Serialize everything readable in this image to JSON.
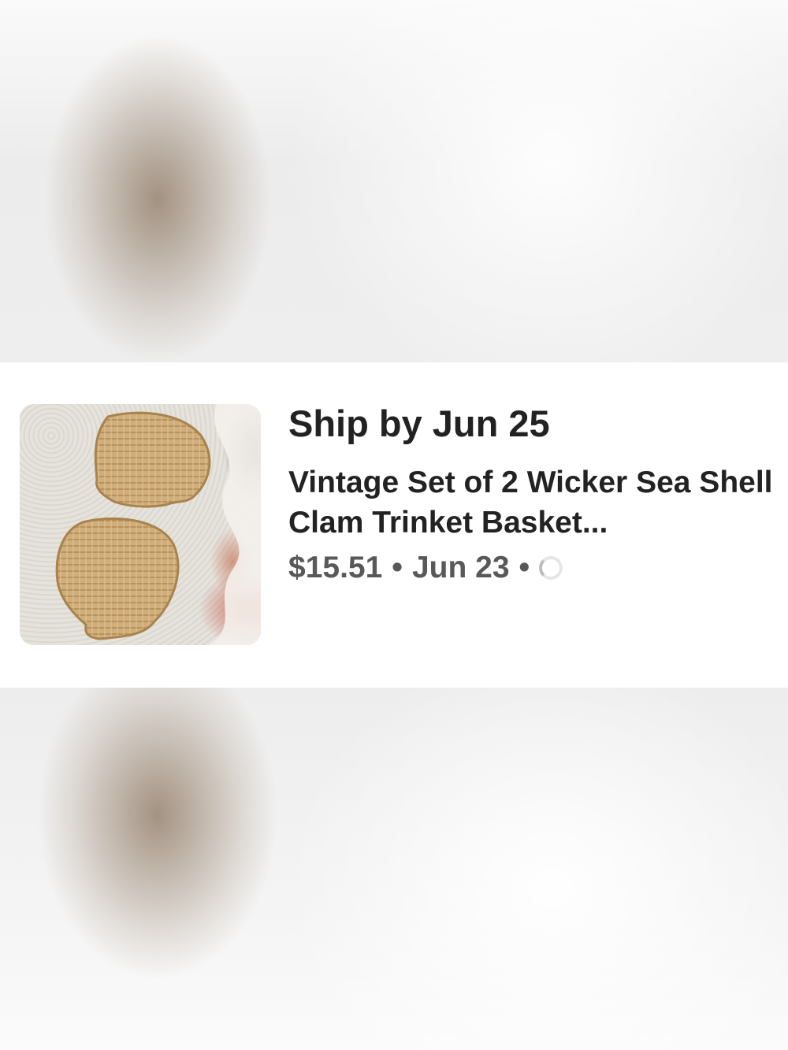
{
  "listing": {
    "ship_by": "Ship by Jun 25",
    "title": "Vintage Set of 2 Wicker Sea Shell Clam Trinket Basket...",
    "price": "$15.51",
    "sold_date": "Jun 23",
    "separator": "•",
    "status_text": "",
    "image_icon": "wicker-shell-baskets-photo",
    "loading_icon": "spinner-icon"
  }
}
